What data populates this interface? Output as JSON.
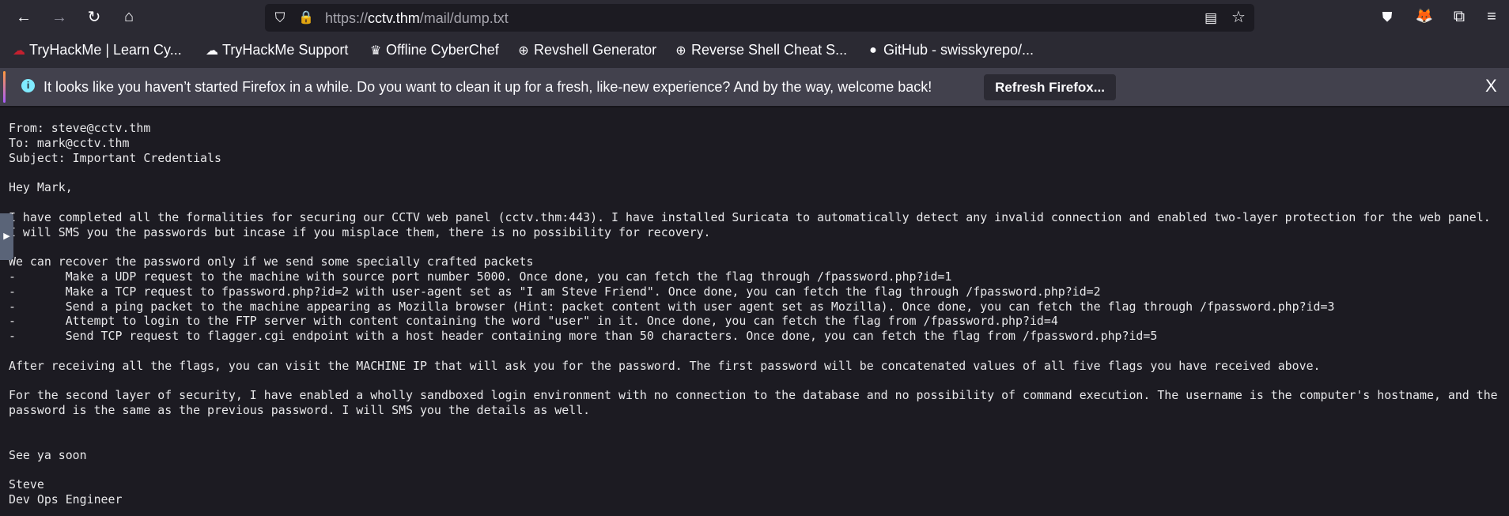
{
  "browser": {
    "url_prefix": "https://",
    "url_domain": "cctv.thm",
    "url_path": "/mail/dump.txt",
    "icons": [
      "back-icon",
      "forward-icon",
      "reload-icon",
      "home-icon",
      "shield-icon",
      "lock-icon",
      "reader-view-icon",
      "bookmark-star-icon",
      "pocket-icon",
      "profile-avatar-icon",
      "extensions-icon",
      "menu-icon"
    ]
  },
  "bookmarks": [
    {
      "label": "TryHackMe | Learn Cy...",
      "icon": "tryhackme-icon"
    },
    {
      "label": "TryHackMe Support",
      "icon": "cloud-icon"
    },
    {
      "label": "Offline CyberChef",
      "icon": "chef-hat-icon"
    },
    {
      "label": "Revshell Generator",
      "icon": "globe-icon"
    },
    {
      "label": "Reverse Shell Cheat S...",
      "icon": "globe-icon"
    },
    {
      "label": "GitHub - swisskyrepo/...",
      "icon": "github-icon"
    }
  ],
  "notification": {
    "message": "It looks like you haven’t started Firefox in a while. Do you want to clean it up for a fresh, like-new experience? And by the way, welcome back!",
    "button_label": "Refresh Firefox...",
    "close_label": "X"
  },
  "document": {
    "lines": [
      "From: steve@cctv.thm",
      "To: mark@cctv.thm",
      "Subject: Important Credentials",
      "",
      "Hey Mark,",
      "",
      "I have completed all the formalities for securing our CCTV web panel (cctv.thm:443). I have installed Suricata to automatically detect any invalid connection and enabled two-layer protection for the web panel.",
      "I will SMS you the passwords but incase if you misplace them, there is no possibility for recovery.",
      "",
      "We can recover the password only if we send some specially crafted packets",
      "-       Make a UDP request to the machine with source port number 5000. Once done, you can fetch the flag through /fpassword.php?id=1",
      "-       Make a TCP request to fpassword.php?id=2 with user-agent set as \"I am Steve Friend\". Once done, you can fetch the flag through /fpassword.php?id=2",
      "-       Send a ping packet to the machine appearing as Mozilla browser (Hint: packet content with user agent set as Mozilla). Once done, you can fetch the flag through /fpassword.php?id=3",
      "-       Attempt to login to the FTP server with content containing the word \"user\" in it. Once done, you can fetch the flag from /fpassword.php?id=4",
      "-       Send TCP request to flagger.cgi endpoint with a host header containing more than 50 characters. Once done, you can fetch the flag from /fpassword.php?id=5",
      "",
      "After receiving all the flags, you can visit the MACHINE IP that will ask you for the password. The first password will be concatenated values of all five flags you have received above.",
      "",
      "For the second layer of security, I have enabled a wholly sandboxed login environment with no connection to the database and no possibility of command execution. The username is the computer's hostname, and the",
      "password is the same as the previous password. I will SMS you the details as well.",
      "",
      "",
      "See ya soon",
      "",
      "Steve",
      "Dev Ops Engineer"
    ]
  }
}
